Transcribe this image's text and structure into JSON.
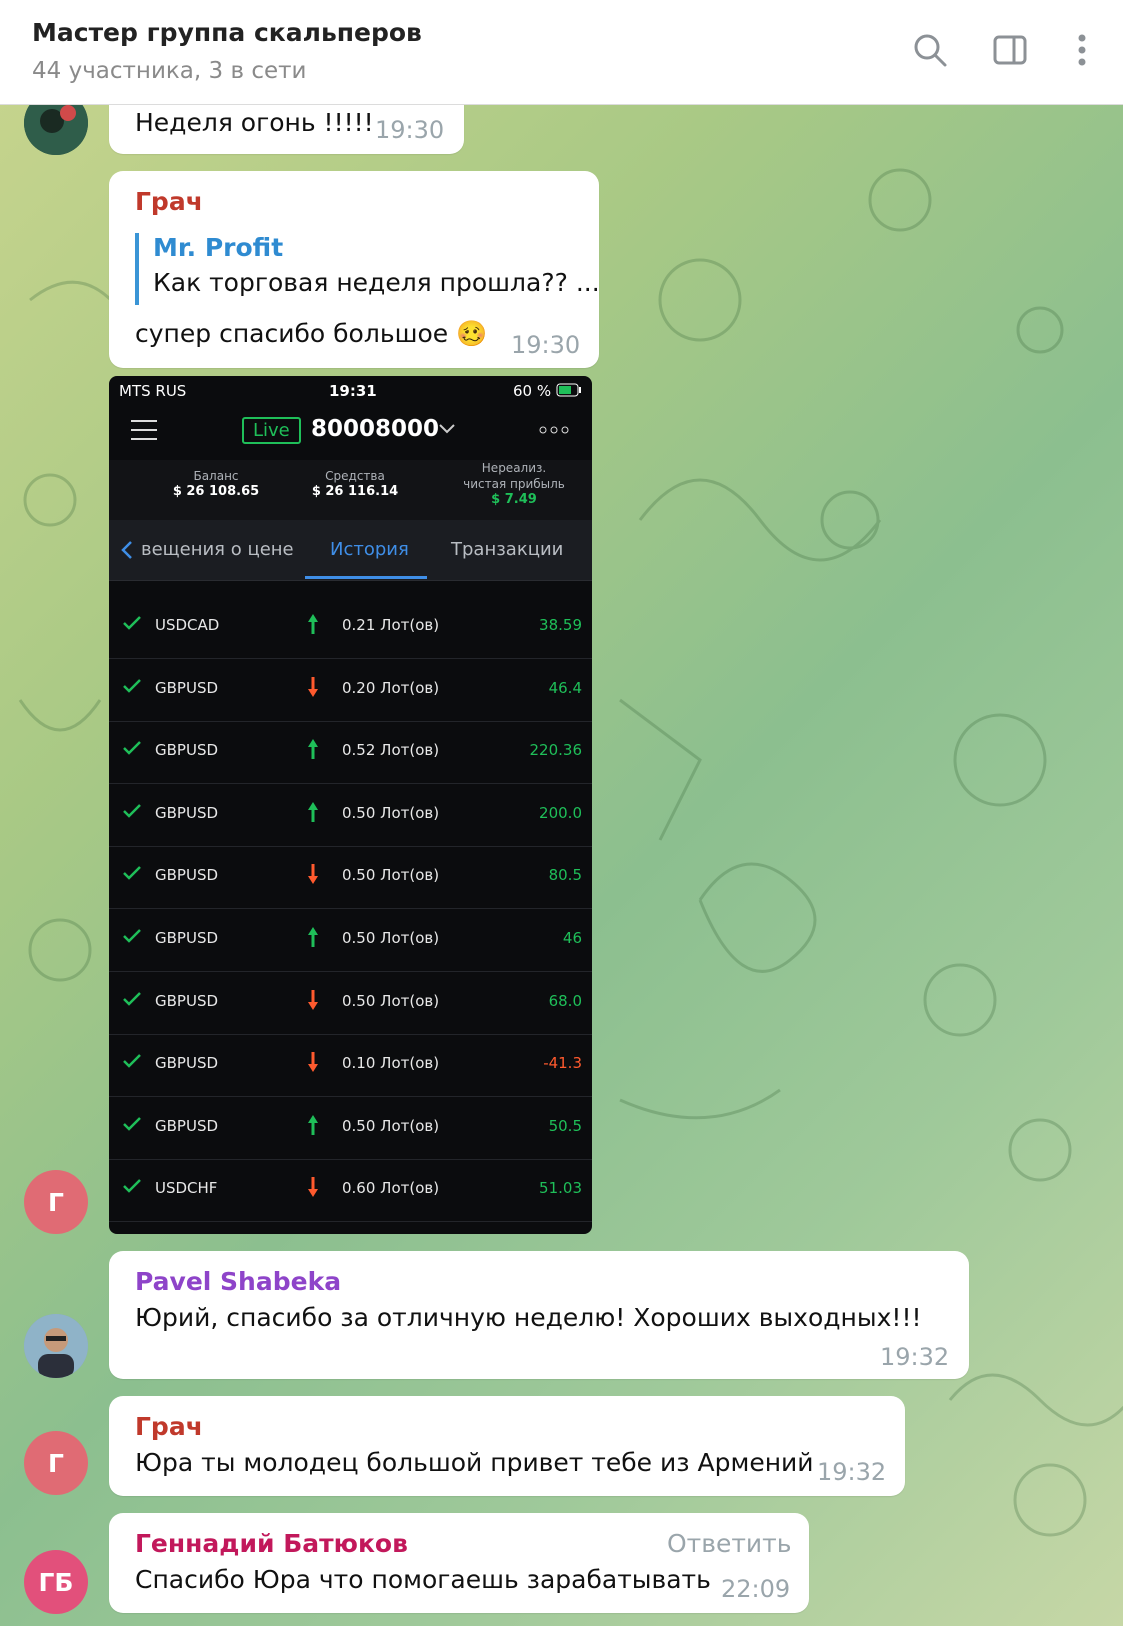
{
  "header": {
    "title": "Мастер группа скальперов",
    "subtitle": "44 участника, 3 в сети",
    "icons": [
      "search-icon",
      "sidebar-toggle-icon",
      "more-vertical-icon"
    ]
  },
  "messages": {
    "m1": {
      "text": "Неделя огонь !!!!!",
      "time": "19:30"
    },
    "m2": {
      "sender": "Грач",
      "reply_author": "Mr. Profit",
      "reply_text": "Как торговая неделя прошла?? ...",
      "text": "супер спасибо большое 🥴",
      "time": "19:30",
      "avatar_initial": "Г"
    },
    "m3": {
      "sender": "Pavel Shabeka",
      "text": "Юрий, спасибо за отличную неделю! Хороших выходных!!!",
      "time": "19:32"
    },
    "m4": {
      "sender": "Грач",
      "text": "Юра ты молодец большой привет тебе из Армений",
      "time": "19:32",
      "avatar_initial": "Г"
    },
    "m5": {
      "sender": "Геннадий Батюков",
      "reply_label": "Ответить",
      "text": "Спасибо Юра что помогаешь  зарабатывать",
      "time": "22:09",
      "avatar_initial": "ГБ"
    }
  },
  "screenshot": {
    "carrier": "MTS RUS",
    "clock": "19:31",
    "battery": "60 %",
    "live_label": "Live",
    "account": "80008000",
    "balance_label": "Баланс",
    "balance": "$ 26 108.65",
    "equity_label": "Средства",
    "equity": "$ 26 116.14",
    "unrealized_label_1": "Нереализ.",
    "unrealized_label_2": "чистая прибыль",
    "unrealized": "$ 7.49",
    "tabs": [
      "вещения о цене",
      "История",
      "Транзакции"
    ],
    "trades": [
      {
        "symbol": "USDCAD",
        "dir": "up",
        "lots": "0.21 Лот(ов)",
        "pnl": "38.59"
      },
      {
        "symbol": "GBPUSD",
        "dir": "down",
        "lots": "0.20 Лот(ов)",
        "pnl": "46.4"
      },
      {
        "symbol": "GBPUSD",
        "dir": "up",
        "lots": "0.52 Лот(ов)",
        "pnl": "220.36"
      },
      {
        "symbol": "GBPUSD",
        "dir": "up",
        "lots": "0.50 Лот(ов)",
        "pnl": "200.0"
      },
      {
        "symbol": "GBPUSD",
        "dir": "down",
        "lots": "0.50 Лот(ов)",
        "pnl": "80.5"
      },
      {
        "symbol": "GBPUSD",
        "dir": "up",
        "lots": "0.50 Лот(ов)",
        "pnl": "46"
      },
      {
        "symbol": "GBPUSD",
        "dir": "down",
        "lots": "0.50 Лот(ов)",
        "pnl": "68.0"
      },
      {
        "symbol": "GBPUSD",
        "dir": "down",
        "lots": "0.10 Лот(ов)",
        "pnl": "-41.3"
      },
      {
        "symbol": "GBPUSD",
        "dir": "up",
        "lots": "0.50 Лот(ов)",
        "pnl": "50.5"
      },
      {
        "symbol": "USDCHF",
        "dir": "down",
        "lots": "0.60 Лот(ов)",
        "pnl": "51.03"
      }
    ]
  },
  "colors": {
    "sender_grach": "#c0392b",
    "sender_pavel": "#8e44c9",
    "sender_gennadiy": "#c2185b",
    "reply_author": "#2f8bd1",
    "avatar_red": "#e06b74",
    "avatar_pink": "#e2507b",
    "profit_green": "#1fbf59",
    "loss_red": "#ff5a2e"
  }
}
